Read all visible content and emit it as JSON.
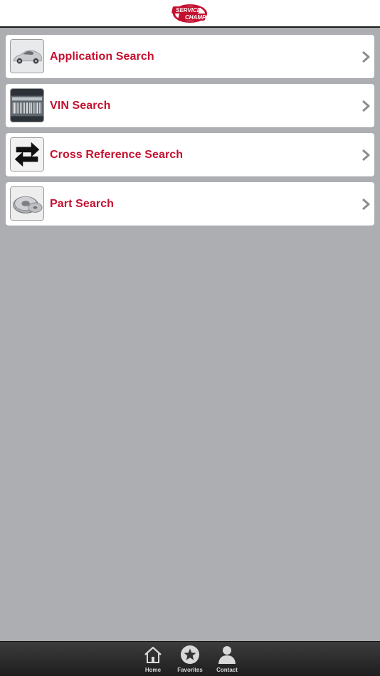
{
  "header": {
    "logo_alt": "Service Champ",
    "logo_line1": "SERVICE",
    "logo_line2": "CHAMP"
  },
  "menu": {
    "items": [
      {
        "label": "Application Search",
        "icon": "car-icon"
      },
      {
        "label": "VIN Search",
        "icon": "barcode-icon"
      },
      {
        "label": "Cross Reference Search",
        "icon": "swap-arrows-icon"
      },
      {
        "label": "Part Search",
        "icon": "brake-rotor-icon"
      }
    ]
  },
  "tabbar": {
    "items": [
      {
        "label": "Home",
        "icon": "home-icon"
      },
      {
        "label": "Favorites",
        "icon": "star-icon"
      },
      {
        "label": "Contact",
        "icon": "person-icon"
      }
    ]
  },
  "colors": {
    "accent": "#c4102f",
    "background": "#adaeb2",
    "tabbar": "#2a2a2a"
  }
}
